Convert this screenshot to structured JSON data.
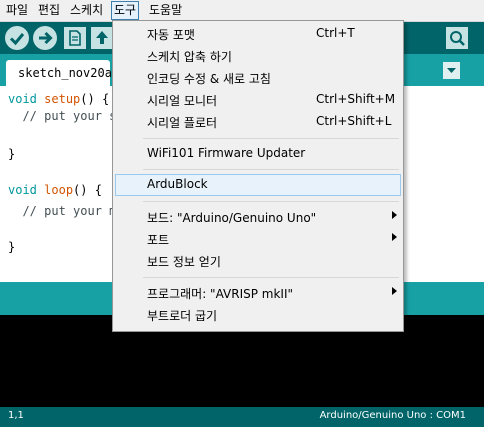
{
  "menubar": {
    "items": [
      {
        "label": "파일"
      },
      {
        "label": "편집"
      },
      {
        "label": "스케치"
      },
      {
        "label": "도구",
        "active": true
      },
      {
        "label": "도움말"
      }
    ]
  },
  "toolbar": {
    "buttons": [
      "verify-icon",
      "upload-icon",
      "new-icon",
      "open-icon",
      "serial-monitor-icon"
    ]
  },
  "tab": {
    "name": "sketch_nov20a"
  },
  "editor": {
    "lines": [
      "void setup() {",
      "  // put your set",
      "",
      "}",
      "",
      "void loop() {",
      "  // put your mai",
      "",
      "}"
    ]
  },
  "status": {
    "line_number": "1,1",
    "board": "Arduino/Genuino Uno : COM1"
  },
  "dropdown": {
    "items": [
      {
        "label": "자동 포맷",
        "shortcut": "Ctrl+T"
      },
      {
        "label": "스케치 압축 하기"
      },
      {
        "label": "인코딩 수정 & 새로 고침"
      },
      {
        "label": "시리얼 모니터",
        "shortcut": "Ctrl+Shift+M"
      },
      {
        "label": "시리얼 플로터",
        "shortcut": "Ctrl+Shift+L"
      },
      {
        "label": "WiFi101 Firmware Updater"
      },
      {
        "label": "ArduBlock",
        "highlighted": true
      },
      {
        "label": "보드: \"Arduino/Genuino Uno\"",
        "submenu": true
      },
      {
        "label": "포트",
        "submenu": true
      },
      {
        "label": "보드 정보 얻기"
      },
      {
        "label": "프로그래머: \"AVRISP mkII\"",
        "submenu": true
      },
      {
        "label": "부트로더 굽기"
      }
    ]
  },
  "colors": {
    "toolbar_bg": "#006468",
    "tab_bg": "#17a1a5",
    "button_bg": "#c6e2e3",
    "keyword": "#00979c",
    "function": "#d35400"
  }
}
